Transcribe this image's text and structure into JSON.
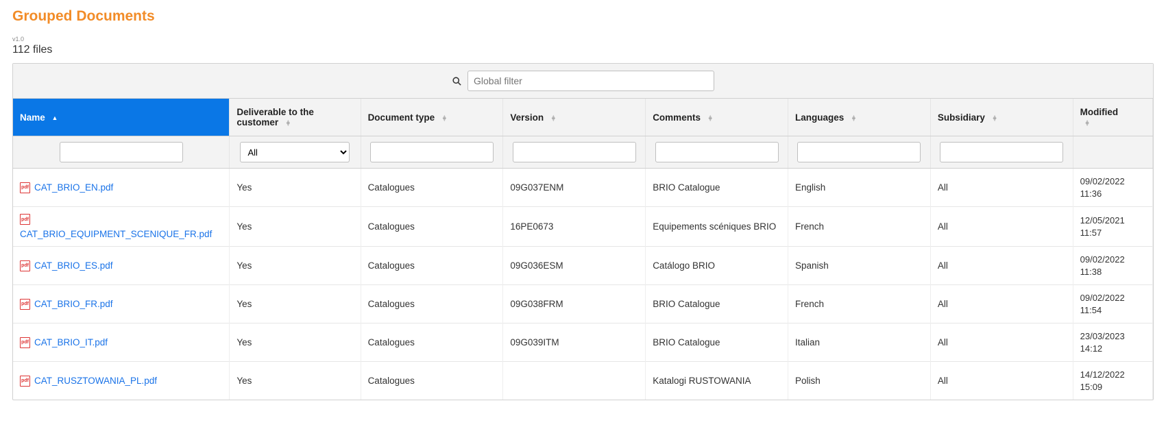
{
  "header": {
    "title": "Grouped Documents",
    "version": "v1.0",
    "file_count": "112 files"
  },
  "filter": {
    "global_placeholder": "Global filter"
  },
  "columns": {
    "name": "Name",
    "deliverable": "Deliverable to the customer",
    "doc_type": "Document type",
    "version": "Version",
    "comments": "Comments",
    "languages": "Languages",
    "subsidiary": "Subsidiary",
    "modified": "Modified"
  },
  "column_filters": {
    "deliverable_selected": "All"
  },
  "rows": [
    {
      "name": "CAT_BRIO_EN.pdf",
      "deliverable": "Yes",
      "doc_type": "Catalogues",
      "version": "09G037ENM",
      "comments": "BRIO Catalogue",
      "languages": "English",
      "subsidiary": "All",
      "modified": "09/02/2022 11:36"
    },
    {
      "name": "CAT_BRIO_EQUIPMENT_SCENIQUE_FR.pdf",
      "deliverable": "Yes",
      "doc_type": "Catalogues",
      "version": "16PE0673",
      "comments": "Equipements scéniques BRIO",
      "languages": "French",
      "subsidiary": "All",
      "modified": "12/05/2021 11:57"
    },
    {
      "name": "CAT_BRIO_ES.pdf",
      "deliverable": "Yes",
      "doc_type": "Catalogues",
      "version": "09G036ESM",
      "comments": "Catálogo BRIO",
      "languages": "Spanish",
      "subsidiary": "All",
      "modified": "09/02/2022 11:38"
    },
    {
      "name": "CAT_BRIO_FR.pdf",
      "deliverable": "Yes",
      "doc_type": "Catalogues",
      "version": "09G038FRM",
      "comments": "BRIO Catalogue",
      "languages": "French",
      "subsidiary": "All",
      "modified": "09/02/2022 11:54"
    },
    {
      "name": "CAT_BRIO_IT.pdf",
      "deliverable": "Yes",
      "doc_type": "Catalogues",
      "version": "09G039ITM",
      "comments": "BRIO Catalogue",
      "languages": "Italian",
      "subsidiary": "All",
      "modified": "23/03/2023 14:12"
    },
    {
      "name": "CAT_RUSZTOWANIA_PL.pdf",
      "deliverable": "Yes",
      "doc_type": "Catalogues",
      "version": "",
      "comments": "Katalogi RUSTOWANIA",
      "languages": "Polish",
      "subsidiary": "All",
      "modified": "14/12/2022 15:09"
    }
  ]
}
